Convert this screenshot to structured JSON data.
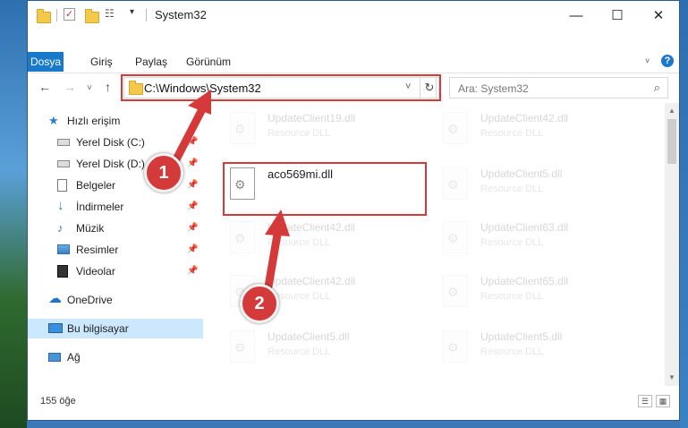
{
  "window": {
    "title": "System32",
    "minimize": "—",
    "maximize": "☐",
    "close": "✕"
  },
  "ribbon": {
    "tabs": [
      "Dosya",
      "Giriş",
      "Paylaş",
      "Görünüm"
    ],
    "help": "?"
  },
  "nav": {
    "back": "←",
    "forward": "→",
    "recent": "˅",
    "up": "↑",
    "address": "C:\\Windows\\System32",
    "dropdown": "˅",
    "refresh": "↻",
    "search_placeholder": "Ara: System32",
    "search_icon": "⌕"
  },
  "sidebar": {
    "items": [
      {
        "label": "Hızlı erişim",
        "icon": "star-icon",
        "pinned": false
      },
      {
        "label": "Yerel Disk (C:)",
        "icon": "drive-icon",
        "pinned": true
      },
      {
        "label": "Yerel Disk (D:)",
        "icon": "drive-icon",
        "pinned": true
      },
      {
        "label": "Belgeler",
        "icon": "document-icon",
        "pinned": true
      },
      {
        "label": "İndirmeler",
        "icon": "download-icon",
        "pinned": true
      },
      {
        "label": "Müzik",
        "icon": "music-icon",
        "pinned": true
      },
      {
        "label": "Resimler",
        "icon": "pictures-icon",
        "pinned": true
      },
      {
        "label": "Videolar",
        "icon": "video-icon",
        "pinned": true
      },
      {
        "label": "OneDrive",
        "icon": "cloud-icon",
        "pinned": false
      },
      {
        "label": "Bu bilgisayar",
        "icon": "computer-icon",
        "pinned": false,
        "selected": true
      },
      {
        "label": "Ağ",
        "icon": "network-icon",
        "pinned": false
      }
    ],
    "pin_glyph": "📌"
  },
  "files": [
    {
      "name": "UpdateClient19.dll",
      "type": "Resource DLL",
      "faded": true
    },
    {
      "name": "UpdateClient42.dll",
      "type": "Resource DLL",
      "faded": true
    },
    {
      "name": "aco569mi.dll",
      "type": "",
      "faded": false,
      "highlighted": true
    },
    {
      "name": "UpdateClient5.dll",
      "type": "Resource DLL",
      "faded": true
    },
    {
      "name": "UpdateClient42.dll",
      "type": "Resource DLL",
      "faded": true
    },
    {
      "name": "UpdateClient63.dll",
      "type": "Resource DLL",
      "faded": true
    },
    {
      "name": "UpdateClient42.dll",
      "type": "Resource DLL",
      "faded": true
    },
    {
      "name": "UpdateClient65.dll",
      "type": "Resource DLL",
      "faded": true
    },
    {
      "name": "UpdateClient5.dll",
      "type": "Resource DLL",
      "faded": true
    },
    {
      "name": "UpdateClient5.dll",
      "type": "Resource DLL",
      "faded": true
    }
  ],
  "status": {
    "count": "155 öğe"
  },
  "annotations": {
    "step1": "1",
    "step2": "2",
    "color": "#d43a3a"
  }
}
